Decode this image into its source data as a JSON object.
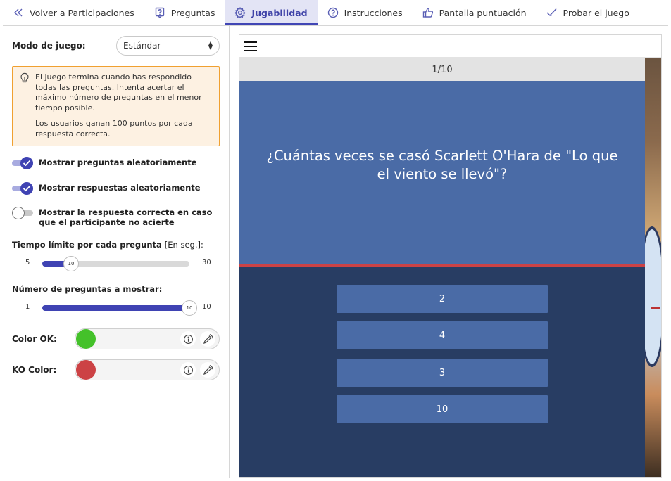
{
  "nav": {
    "back_label": "Volver a Participaciones",
    "tabs": [
      {
        "label": "Preguntas",
        "icon": "question-box-icon"
      },
      {
        "label": "Jugabilidad",
        "icon": "gear-icon",
        "active": true
      },
      {
        "label": "Instrucciones",
        "icon": "help-circle-icon"
      },
      {
        "label": "Pantalla puntuación",
        "icon": "thumbs-up-icon"
      },
      {
        "label": "Probar el juego",
        "icon": "check-double-icon"
      }
    ]
  },
  "settings": {
    "mode_label": "Modo de juego:",
    "mode_value": "Estándar",
    "info_lines": [
      "El juego termina cuando has respondido todas las preguntas. Intenta acertar el máximo número de preguntas en el menor tiempo posible.",
      "Los usuarios ganan 100 puntos por cada respuesta correcta."
    ],
    "toggles": [
      {
        "label": "Mostrar preguntas aleatoriamente",
        "on": true
      },
      {
        "label": "Mostrar respuestas aleatoriamente",
        "on": true
      },
      {
        "label": "Mostrar la respuesta correcta en caso que el participante no acierte",
        "on": false
      }
    ],
    "time_limit": {
      "label": "Tiempo límite por cada pregunta",
      "unit": "[En seg.]:",
      "min": "5",
      "max": "30",
      "value": 10
    },
    "num_questions": {
      "label": "Número de preguntas a mostrar:",
      "min": "1",
      "max": "10",
      "value": 10
    },
    "color_ok": {
      "label": "Color OK:",
      "color": "#44c12a"
    },
    "color_ko": {
      "label": "KO Color:",
      "color": "#cc4245"
    }
  },
  "preview": {
    "progress": "1/10",
    "question": "¿Cuántas veces se casó Scarlett O'Hara de \"Lo que el viento se llevó\"?",
    "answers": [
      "2",
      "4",
      "3",
      "10"
    ]
  }
}
